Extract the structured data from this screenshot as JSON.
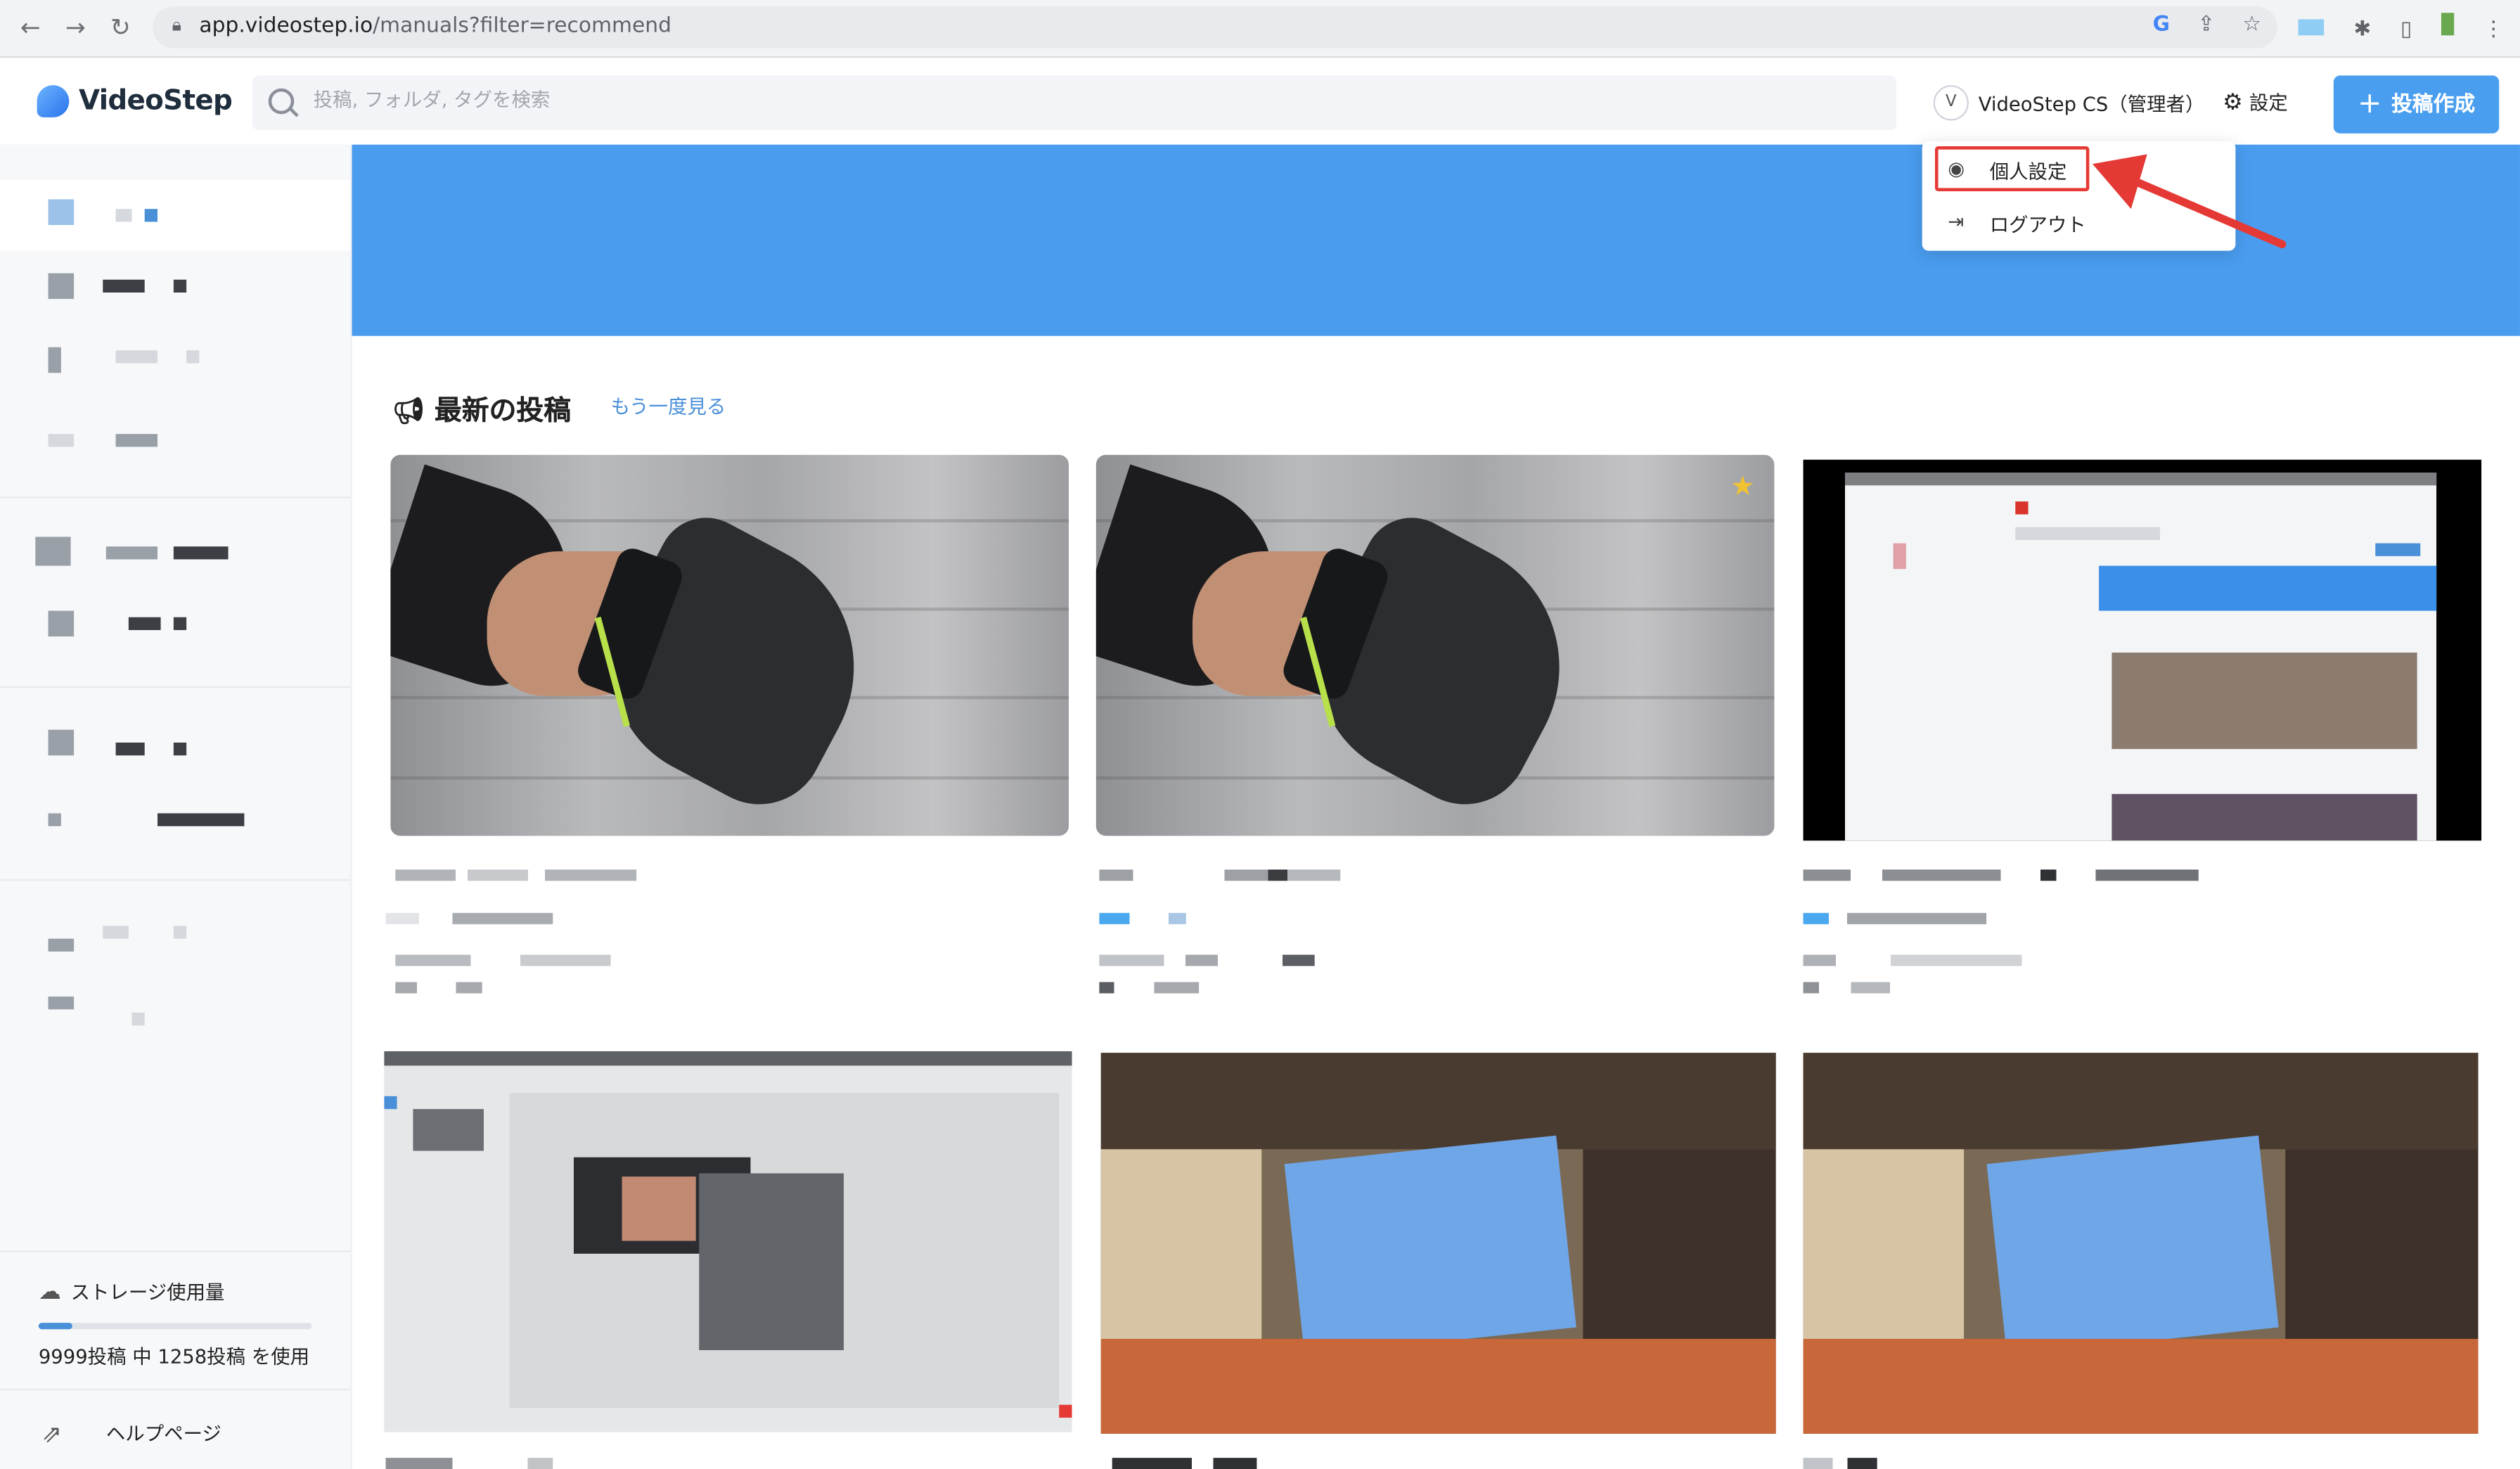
{
  "browser": {
    "url_host": "app.videostep.io",
    "url_path": "/manuals?filter=recommend",
    "back_icon": "arrow-left-icon",
    "forward_icon": "arrow-right-icon",
    "reload_icon": "reload-icon"
  },
  "header": {
    "logo_text": "VideoStep",
    "search_placeholder": "投稿, フォルダ, タグを検索",
    "user_initial": "V",
    "user_name": "VideoStep CS（管理者）",
    "settings_label": "設定",
    "create_label": "投稿作成"
  },
  "dropdown": {
    "items": [
      {
        "label": "個人設定",
        "icon": "user-circle-icon"
      },
      {
        "label": "ログアウト",
        "icon": "logout-icon"
      }
    ]
  },
  "main": {
    "section_title": "最新の投稿",
    "see_again_label": "もう一度見る"
  },
  "sidebar": {
    "storage_title": "ストレージ使用量",
    "storage_text": "9999投稿 中 1258投稿 を使用",
    "storage_used_fraction": 0.1258,
    "help_label": "ヘルプページ"
  },
  "colors": {
    "accent": "#4a9cef",
    "highlight": "#e53935",
    "star": "#f1c232"
  }
}
